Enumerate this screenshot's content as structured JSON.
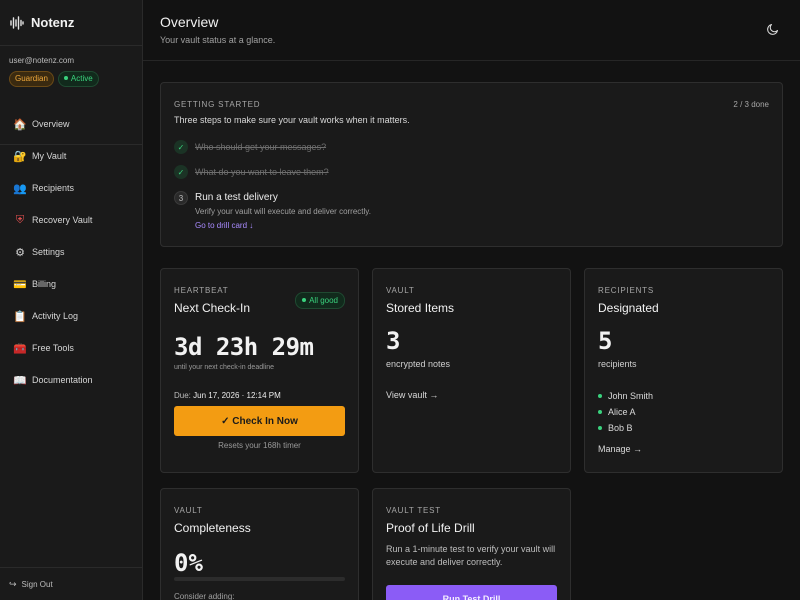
{
  "app": {
    "name": "Notenz"
  },
  "user": {
    "email": "user@notenz.com",
    "role_badge": "Guardian",
    "status_badge": "Active"
  },
  "sidebar": {
    "items": [
      {
        "label": "Overview",
        "icon": "house-icon",
        "glyph": "🏠"
      },
      {
        "label": "My Vault",
        "icon": "lock-icon",
        "glyph": "🔐"
      },
      {
        "label": "Recipients",
        "icon": "people-icon",
        "glyph": "👥"
      },
      {
        "label": "Recovery Vault",
        "icon": "shield-icon",
        "glyph": "⛨"
      },
      {
        "label": "Settings",
        "icon": "gear-icon",
        "glyph": "⚙"
      },
      {
        "label": "Billing",
        "icon": "card-icon",
        "glyph": "💳"
      },
      {
        "label": "Activity Log",
        "icon": "clipboard-icon",
        "glyph": "📋"
      },
      {
        "label": "Free Tools",
        "icon": "toolbox-icon",
        "glyph": "🧰"
      },
      {
        "label": "Documentation",
        "icon": "book-icon",
        "glyph": "📖"
      }
    ],
    "signout": "Sign Out"
  },
  "header": {
    "title": "Overview",
    "subtitle": "Your vault status at a glance."
  },
  "getting_started": {
    "eyebrow": "GETTING STARTED",
    "progress": "2 / 3 done",
    "description": "Three steps to make sure your vault works when it matters.",
    "steps": [
      {
        "label": "Who should get your messages?",
        "done": true
      },
      {
        "label": "What do you want to leave them?",
        "done": true
      },
      {
        "number": "3",
        "label": "Run a test delivery",
        "sub": "Verify your vault will execute and deliver correctly.",
        "link": "Go to drill card ↓",
        "done": false
      }
    ]
  },
  "heartbeat": {
    "eyebrow": "HEARTBEAT",
    "title": "Next Check-In",
    "status": "All good",
    "countdown": "3d 23h 29m",
    "countdown_sub": "until your next check-in deadline",
    "due_label": "Due:",
    "due_value": "Jun 17, 2026 · 12:14 PM",
    "button": "✓ Check In Now",
    "note": "Resets your 168h timer"
  },
  "vault": {
    "eyebrow": "VAULT",
    "title": "Stored Items",
    "count": "3",
    "count_label": "encrypted notes",
    "link": "View vault →"
  },
  "recipients": {
    "eyebrow": "RECIPIENTS",
    "title": "Designated",
    "count": "5",
    "count_label": "recipients",
    "names": [
      "John Smith",
      "Alice A",
      "Bob B"
    ],
    "link": "Manage →"
  },
  "completeness": {
    "eyebrow": "VAULT",
    "title": "Completeness",
    "percent_label": "0%",
    "percent": 0,
    "consider": "Consider adding:"
  },
  "drill": {
    "eyebrow": "VAULT TEST",
    "title": "Proof of Life Drill",
    "description": "Run a 1-minute test to verify your vault will execute and deliver correctly.",
    "button": "Run Test Drill"
  },
  "colors": {
    "accent_orange": "#f39c12",
    "accent_purple": "#8b5cf6",
    "success_green": "#3ad27d"
  }
}
